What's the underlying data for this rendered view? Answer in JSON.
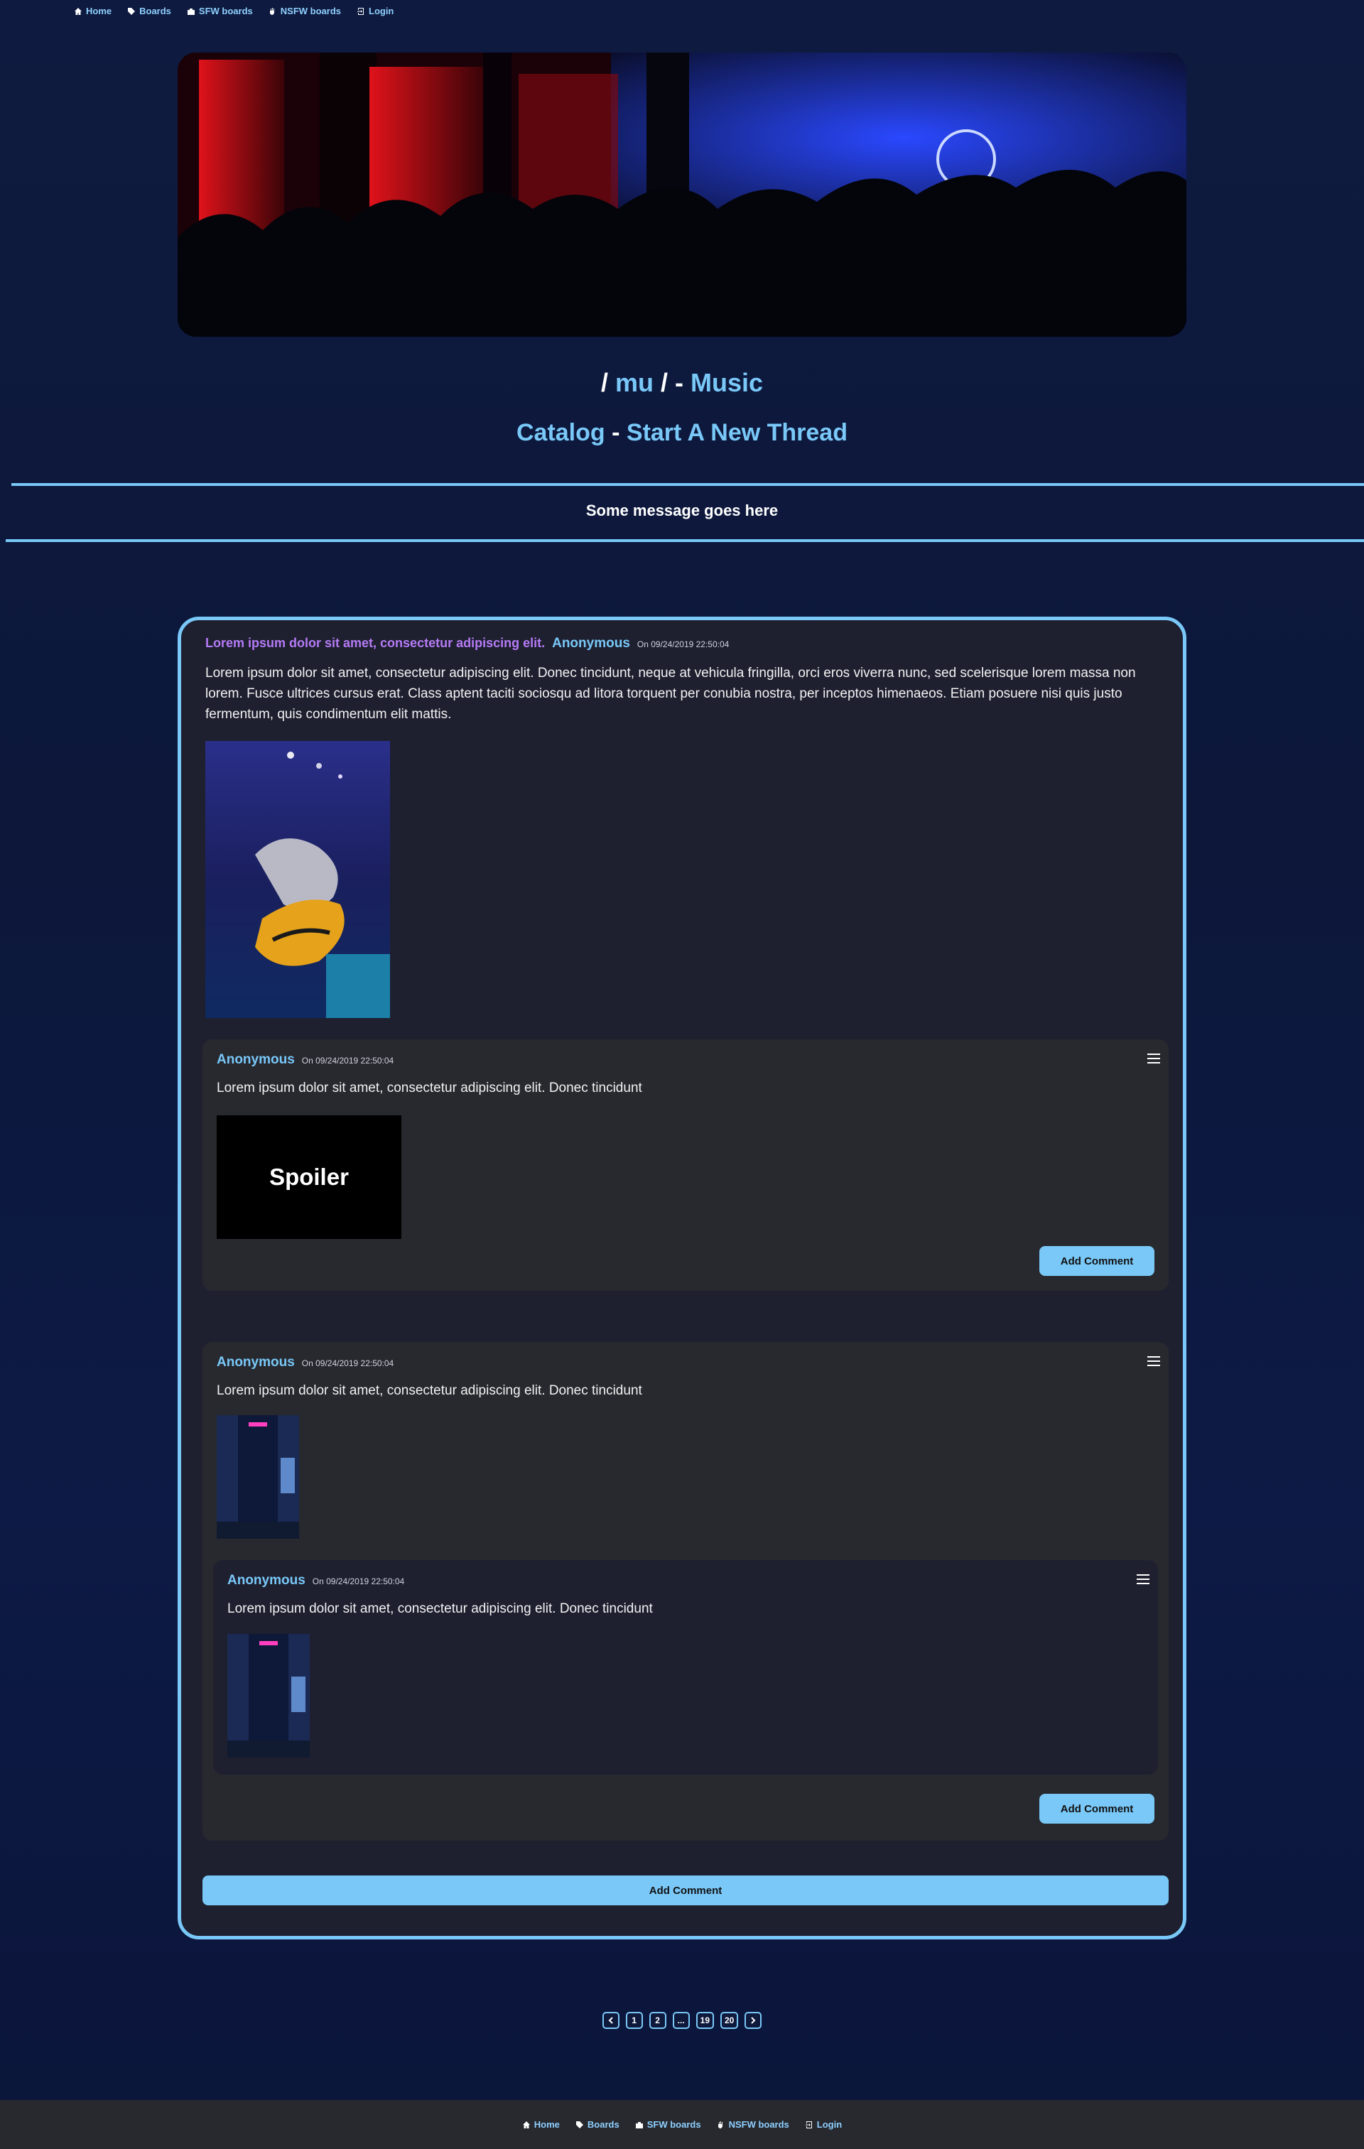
{
  "nav": {
    "home": "Home",
    "boards": "Boards",
    "sfw": "SFW boards",
    "nsfw": "NSFW boards",
    "login": "Login"
  },
  "board": {
    "slug": "mu",
    "name": "Music",
    "catalog": "Catalog",
    "new_thread": "Start A New Thread"
  },
  "message": "Some message goes here",
  "thread": {
    "subject": "Lorem ipsum dolor sit amet, consectetur adipiscing elit.",
    "author": "Anonymous",
    "date": "On 09/24/2019 22:50:04",
    "body": "Lorem ipsum dolor sit amet, consectetur adipiscing elit. Donec tincidunt, neque at vehicula fringilla, orci eros viverra nunc, sed scelerisque lorem massa non lorem. Fusce ultrices cursus erat. Class aptent taciti sociosqu ad litora torquent per conubia nostra, per inceptos himenaeos. Etiam posuere nisi quis justo fermentum, quis condimentum elit mattis.",
    "replies": [
      {
        "author": "Anonymous",
        "date": "On 09/24/2019 22:50:04",
        "body": "Lorem ipsum dolor sit amet, consectetur adipiscing elit. Donec tincidunt",
        "spoiler": "Spoiler",
        "button": "Add Comment"
      },
      {
        "author": "Anonymous",
        "date": "On 09/24/2019 22:50:04",
        "body": "Lorem ipsum dolor sit amet, consectetur adipiscing elit. Donec tincidunt",
        "button": "Add Comment",
        "nested": {
          "author": "Anonymous",
          "date": "On 09/24/2019 22:50:04",
          "body": "Lorem ipsum dolor sit amet, consectetur adipiscing elit. Donec tincidunt"
        }
      }
    ],
    "add_comment": "Add Comment"
  },
  "pagination": {
    "pages": [
      "1",
      "2",
      "...",
      "19",
      "20"
    ]
  },
  "colors": {
    "accent": "#79c8f8",
    "subject": "#b57bf5",
    "card": "#27292f"
  }
}
